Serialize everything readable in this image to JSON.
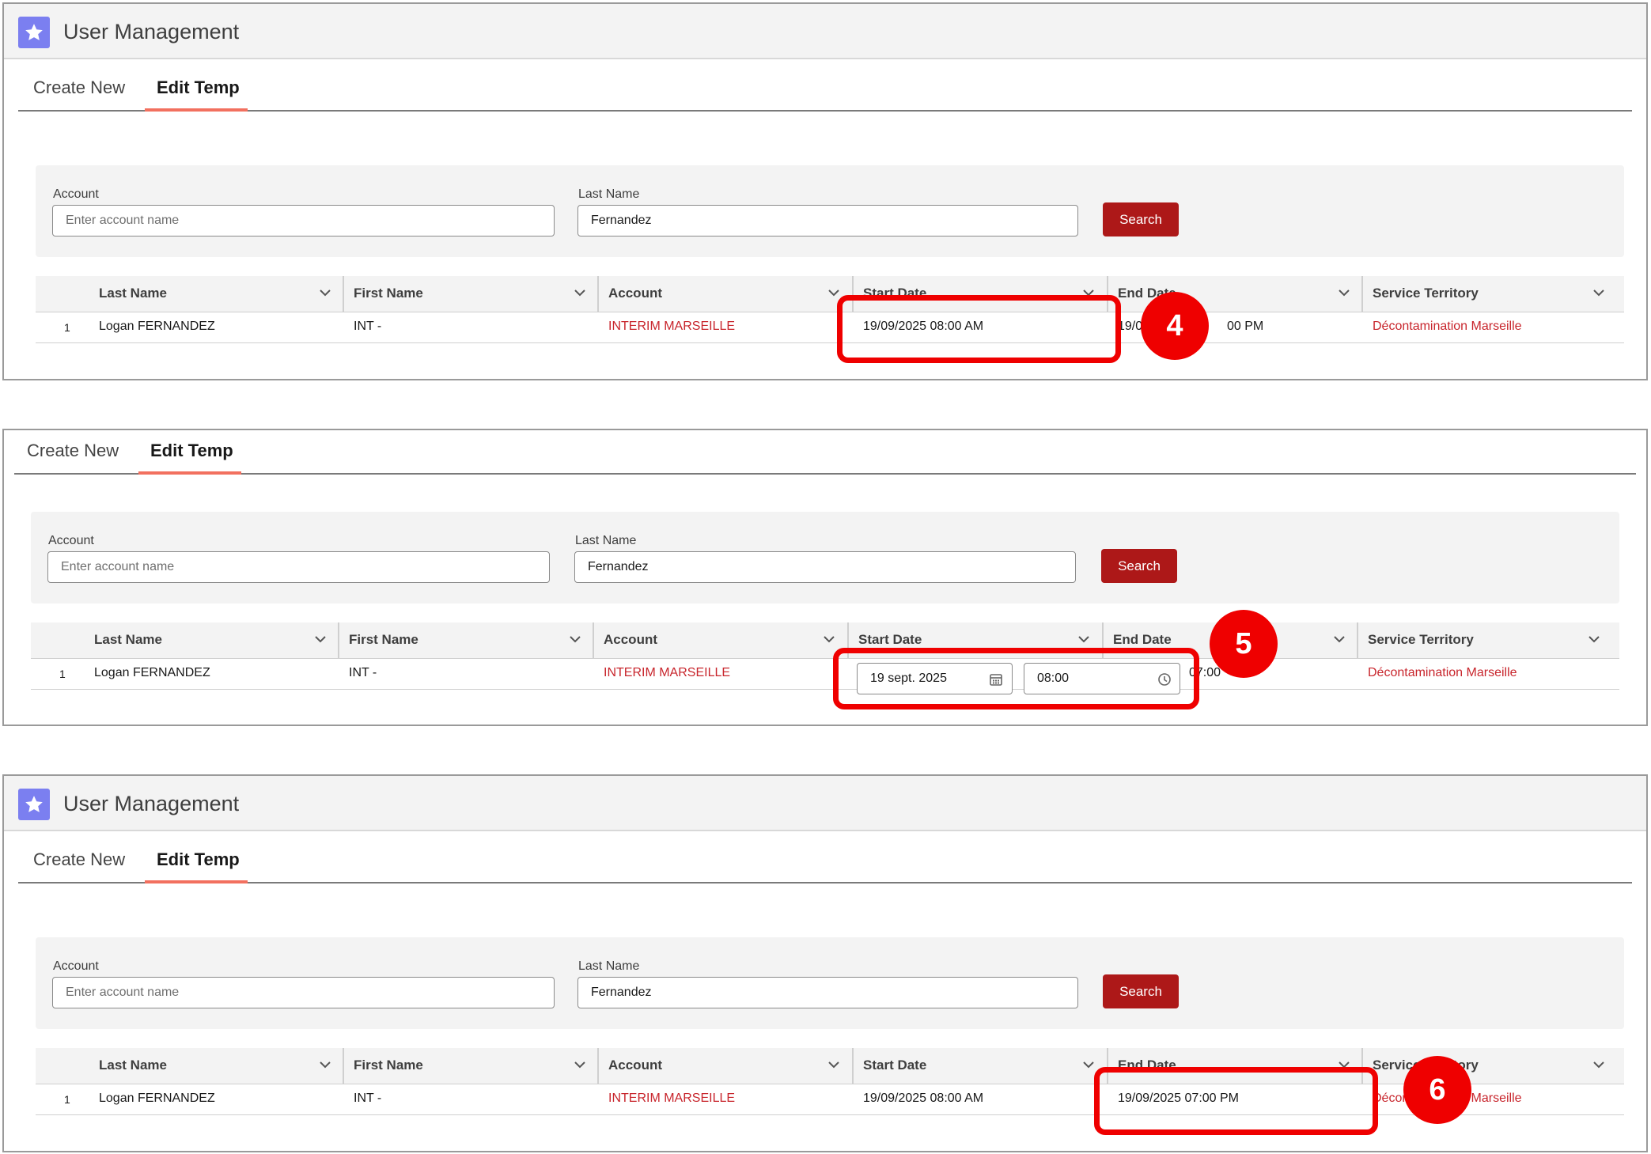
{
  "app": {
    "title": "User Management",
    "icon": "star-icon"
  },
  "tabs": {
    "create_new": "Create New",
    "edit_temp": "Edit Temp"
  },
  "search": {
    "account_label": "Account",
    "account_placeholder": "Enter account name",
    "last_name_label": "Last Name",
    "last_name_value": "Fernandez",
    "button_label": "Search"
  },
  "columns": {
    "last_name": "Last Name",
    "first_name": "First Name",
    "account": "Account",
    "start_date": "Start Date",
    "end_date": "End Date",
    "service_territory": "Service Territory"
  },
  "row": {
    "index": "1",
    "last_name": "Logan FERNANDEZ",
    "first_name": "INT -",
    "account": "INTERIM MARSEILLE",
    "start_date": "19/09/2025 08:00 AM",
    "end_date": "19/09/2025 07:00 PM",
    "end_date_partial_prefix": "19/0",
    "end_date_partial_suffix": "00 PM",
    "end_date_partial_step5": "07:00",
    "service_territory": "Décontamination Marseille"
  },
  "edit_start": {
    "date": "19 sept. 2025",
    "time": "08:00"
  },
  "steps": {
    "step4": "4",
    "step5": "5",
    "step6": "6"
  },
  "colors": {
    "accent": "#ad1818",
    "highlight": "#ef0000",
    "link": "#c8252c",
    "app_icon": "#7b7ff0"
  }
}
